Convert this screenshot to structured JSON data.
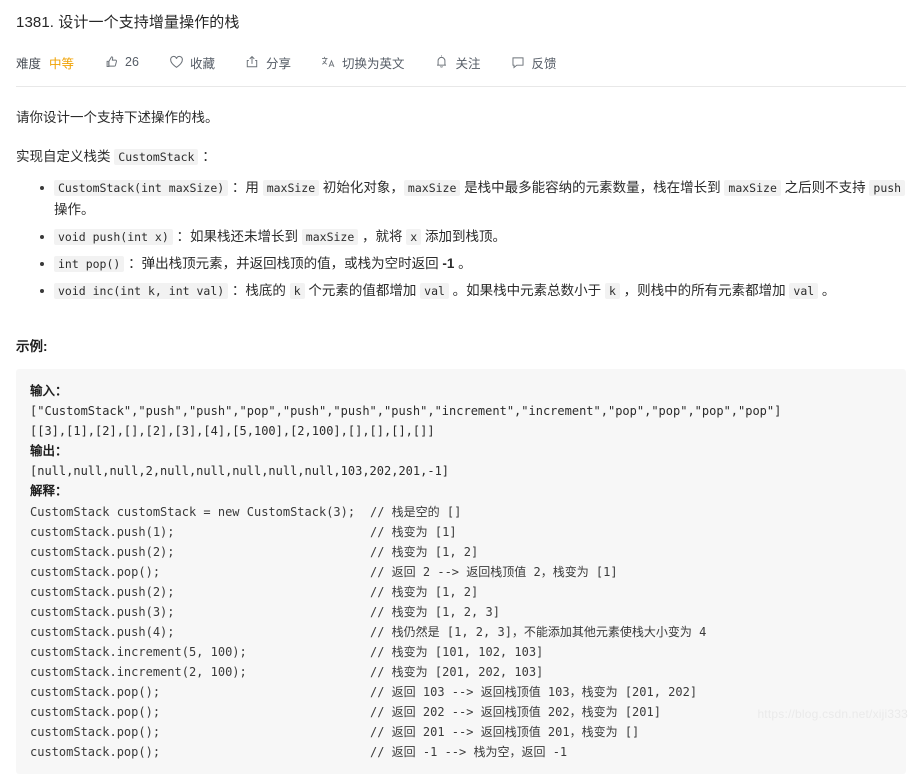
{
  "header": {
    "title": "1381. 设计一个支持增量操作的栈",
    "toolbar": {
      "difficulty_label": "难度",
      "difficulty_value": "中等",
      "difficulty_color": "#f0a202",
      "like_icon": "thumbs-up-icon",
      "like_count": "26",
      "favorite_icon": "heart-icon",
      "favorite_label": "收藏",
      "share_icon": "share-icon",
      "share_label": "分享",
      "translate_icon": "translate-icon",
      "translate_label": "切换为英文",
      "subscribe_icon": "bell-icon",
      "subscribe_label": "关注",
      "feedback_icon": "comment-icon",
      "feedback_label": "反馈"
    }
  },
  "body": {
    "intro": "请你设计一个支持下述操作的栈。",
    "implement_prefix": "实现自定义栈类 ",
    "implement_code": "CustomStack",
    "implement_suffix": " ：",
    "spec_items": [
      {
        "signature": "CustomStack(int maxSize)",
        "parts": [
          {
            "t": "text",
            "v": " ：用 "
          },
          {
            "t": "code",
            "v": "maxSize"
          },
          {
            "t": "text",
            "v": " 初始化对象，"
          },
          {
            "t": "code",
            "v": "maxSize"
          },
          {
            "t": "text",
            "v": " 是栈中最多能容纳的元素数量，栈在增长到 "
          },
          {
            "t": "code",
            "v": "maxSize"
          },
          {
            "t": "text",
            "v": " 之后则不支持 "
          },
          {
            "t": "code",
            "v": "push"
          },
          {
            "t": "text",
            "v": " 操作。"
          }
        ]
      },
      {
        "signature": "void push(int x)",
        "parts": [
          {
            "t": "text",
            "v": " ：如果栈还未增长到 "
          },
          {
            "t": "code",
            "v": "maxSize"
          },
          {
            "t": "text",
            "v": " ，就将 "
          },
          {
            "t": "code",
            "v": "x"
          },
          {
            "t": "text",
            "v": " 添加到栈顶。"
          }
        ]
      },
      {
        "signature": "int pop()",
        "parts": [
          {
            "t": "text",
            "v": " ：弹出栈顶元素，并返回栈顶的值，或栈为空时返回 "
          },
          {
            "t": "bold",
            "v": "-1"
          },
          {
            "t": "text",
            "v": " 。"
          }
        ]
      },
      {
        "signature": "void inc(int k, int val)",
        "parts": [
          {
            "t": "text",
            "v": " ：栈底的 "
          },
          {
            "t": "code",
            "v": "k"
          },
          {
            "t": "text",
            "v": " 个元素的值都增加 "
          },
          {
            "t": "code",
            "v": "val"
          },
          {
            "t": "text",
            "v": " 。如果栈中元素总数小于 "
          },
          {
            "t": "code",
            "v": "k"
          },
          {
            "t": "text",
            "v": " ，则栈中的所有元素都增加 "
          },
          {
            "t": "code",
            "v": "val"
          },
          {
            "t": "text",
            "v": " 。"
          }
        ]
      }
    ],
    "example_heading": "示例:",
    "example": {
      "input_label": "输入：",
      "input_lines": [
        "[\"CustomStack\",\"push\",\"push\",\"pop\",\"push\",\"push\",\"push\",\"increment\",\"increment\",\"pop\",\"pop\",\"pop\",\"pop\"]",
        "[[3],[1],[2],[],[2],[3],[4],[5,100],[2,100],[],[],[],[]]"
      ],
      "output_label": "输出：",
      "output_lines": [
        "[null,null,null,2,null,null,null,null,null,103,202,201,-1]"
      ],
      "explain_label": "解释：",
      "explain_lines": [
        {
          "stmt": "CustomStack customStack = new CustomStack(3);",
          "comment": "// 栈是空的 []"
        },
        {
          "stmt": "customStack.push(1);",
          "comment": "// 栈变为 [1]"
        },
        {
          "stmt": "customStack.push(2);",
          "comment": "// 栈变为 [1, 2]"
        },
        {
          "stmt": "customStack.pop();",
          "comment": "// 返回 2 --> 返回栈顶值 2，栈变为 [1]"
        },
        {
          "stmt": "customStack.push(2);",
          "comment": "// 栈变为 [1, 2]"
        },
        {
          "stmt": "customStack.push(3);",
          "comment": "// 栈变为 [1, 2, 3]"
        },
        {
          "stmt": "customStack.push(4);",
          "comment": "// 栈仍然是 [1, 2, 3]，不能添加其他元素使栈大小变为 4"
        },
        {
          "stmt": "customStack.increment(5, 100);",
          "comment": "// 栈变为 [101, 102, 103]"
        },
        {
          "stmt": "customStack.increment(2, 100);",
          "comment": "// 栈变为 [201, 202, 103]"
        },
        {
          "stmt": "customStack.pop();",
          "comment": "// 返回 103 --> 返回栈顶值 103，栈变为 [201, 202]"
        },
        {
          "stmt": "customStack.pop();",
          "comment": "// 返回 202 --> 返回栈顶值 202，栈变为 [201]"
        },
        {
          "stmt": "customStack.pop();",
          "comment": "// 返回 201 --> 返回栈顶值 201，栈变为 []"
        },
        {
          "stmt": "customStack.pop();",
          "comment": "// 返回 -1 --> 栈为空，返回 -1"
        }
      ]
    }
  },
  "watermark": "https://blog.csdn.net/xiji333"
}
